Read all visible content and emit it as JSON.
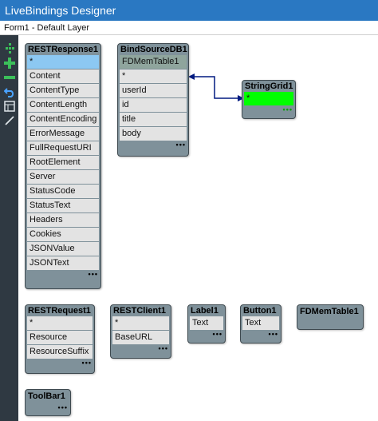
{
  "window": {
    "title": "LiveBindings Designer"
  },
  "layer": {
    "label": "Form1  - Default Layer"
  },
  "toolbar": {
    "icons": [
      "grid-dots-icon",
      "add-icon",
      "remove-icon",
      "undo-icon",
      "layers-icon",
      "link-icon"
    ]
  },
  "nodes": {
    "rest_response": {
      "title": "RESTResponse1",
      "rows": [
        "*",
        "Content",
        "ContentType",
        "ContentLength",
        "ContentEncoding",
        "ErrorMessage",
        "FullRequestURI",
        "RootElement",
        "Server",
        "StatusCode",
        "StatusText",
        "Headers",
        "Cookies",
        "JSONValue",
        "JSONText"
      ],
      "more": "•••"
    },
    "bind_source": {
      "title": "BindSourceDB1",
      "component": "FDMemTable1",
      "rows": [
        "*",
        "userId",
        "id",
        "title",
        "body"
      ],
      "more": "•••"
    },
    "string_grid": {
      "title": "StringGrid1",
      "rows": [
        "*"
      ],
      "more": "•••"
    },
    "rest_request": {
      "title": "RESTRequest1",
      "rows": [
        "*",
        "Resource",
        "ResourceSuffix"
      ],
      "more": "•••"
    },
    "rest_client": {
      "title": "RESTClient1",
      "rows": [
        "*",
        "BaseURL"
      ],
      "more": "•••"
    },
    "label": {
      "title": "Label1",
      "rows": [
        "Text"
      ],
      "more": "•••"
    },
    "button": {
      "title": "Button1",
      "rows": [
        "Text"
      ],
      "more": "•••"
    },
    "fd_mem_table": {
      "title": "FDMemTable1"
    },
    "tool_bar": {
      "title": "ToolBar1",
      "more": "•••"
    }
  },
  "colors": {
    "title_bar": "#2a78c2",
    "node_body": "#7f919a",
    "selected_row": "#8cc8f2",
    "grid_row": "#00ff00",
    "link_line": "#001a80"
  }
}
